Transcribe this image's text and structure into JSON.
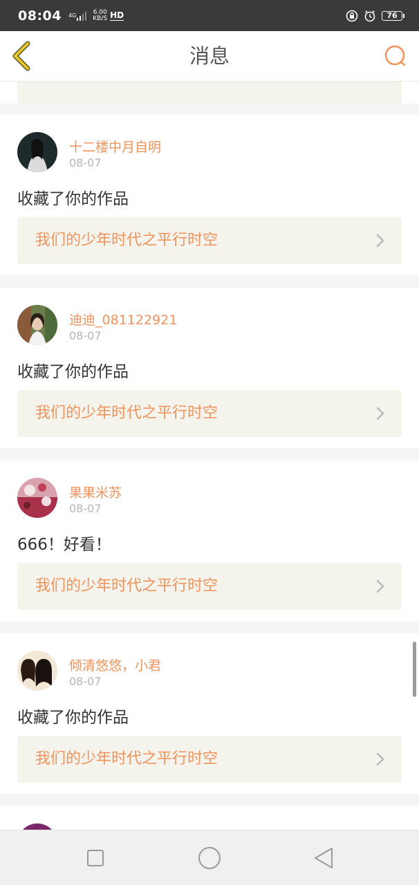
{
  "status": {
    "time": "08:04",
    "net_type": "4G",
    "speed_value": "6.00",
    "speed_unit": "KB/S",
    "hd": "HD",
    "battery": "76"
  },
  "header": {
    "title": "消息",
    "back_icon": "chevron-left-icon",
    "search_icon": "search-icon"
  },
  "messages": [
    {
      "username": "十二楼中月自明",
      "date": "08-07",
      "text": "收藏了你的作品",
      "work_title": "我们的少年时代之平行时空"
    },
    {
      "username": "迪迪_081122921",
      "date": "08-07",
      "text": "收藏了你的作品",
      "work_title": "我们的少年时代之平行时空"
    },
    {
      "username": "果果米苏",
      "date": "08-07",
      "text": "666！好看！",
      "work_title": "我们的少年时代之平行时空"
    },
    {
      "username": "倾清悠悠，小君",
      "date": "08-07",
      "text": "收藏了你的作品",
      "work_title": "我们的少年时代之平行时空"
    }
  ],
  "colors": {
    "accent": "#f0935c",
    "back_icon": "#e8c52a",
    "link_bg": "#f4f4ed"
  },
  "navbar": {
    "icons": [
      "square-recent-icon",
      "circle-home-icon",
      "triangle-back-icon"
    ]
  }
}
